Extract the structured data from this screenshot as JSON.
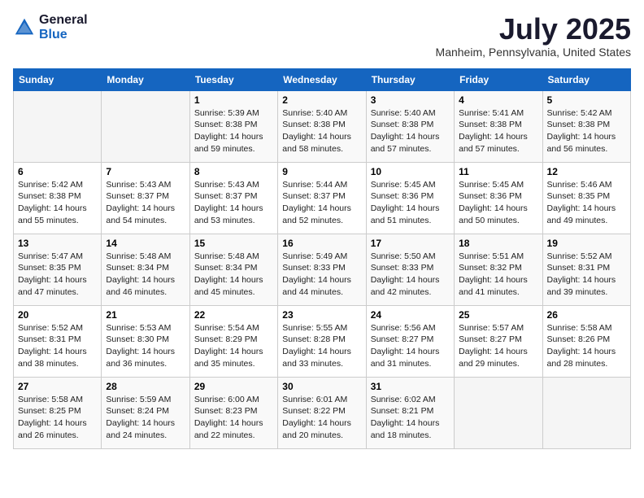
{
  "header": {
    "logo_general": "General",
    "logo_blue": "Blue",
    "month_title": "July 2025",
    "location": "Manheim, Pennsylvania, United States"
  },
  "days_of_week": [
    "Sunday",
    "Monday",
    "Tuesday",
    "Wednesday",
    "Thursday",
    "Friday",
    "Saturday"
  ],
  "weeks": [
    [
      {
        "day": "",
        "info": ""
      },
      {
        "day": "",
        "info": ""
      },
      {
        "day": "1",
        "sunrise": "5:39 AM",
        "sunset": "8:38 PM",
        "daylight": "14 hours and 59 minutes."
      },
      {
        "day": "2",
        "sunrise": "5:40 AM",
        "sunset": "8:38 PM",
        "daylight": "14 hours and 58 minutes."
      },
      {
        "day": "3",
        "sunrise": "5:40 AM",
        "sunset": "8:38 PM",
        "daylight": "14 hours and 57 minutes."
      },
      {
        "day": "4",
        "sunrise": "5:41 AM",
        "sunset": "8:38 PM",
        "daylight": "14 hours and 57 minutes."
      },
      {
        "day": "5",
        "sunrise": "5:42 AM",
        "sunset": "8:38 PM",
        "daylight": "14 hours and 56 minutes."
      }
    ],
    [
      {
        "day": "6",
        "sunrise": "5:42 AM",
        "sunset": "8:38 PM",
        "daylight": "14 hours and 55 minutes."
      },
      {
        "day": "7",
        "sunrise": "5:43 AM",
        "sunset": "8:37 PM",
        "daylight": "14 hours and 54 minutes."
      },
      {
        "day": "8",
        "sunrise": "5:43 AM",
        "sunset": "8:37 PM",
        "daylight": "14 hours and 53 minutes."
      },
      {
        "day": "9",
        "sunrise": "5:44 AM",
        "sunset": "8:37 PM",
        "daylight": "14 hours and 52 minutes."
      },
      {
        "day": "10",
        "sunrise": "5:45 AM",
        "sunset": "8:36 PM",
        "daylight": "14 hours and 51 minutes."
      },
      {
        "day": "11",
        "sunrise": "5:45 AM",
        "sunset": "8:36 PM",
        "daylight": "14 hours and 50 minutes."
      },
      {
        "day": "12",
        "sunrise": "5:46 AM",
        "sunset": "8:35 PM",
        "daylight": "14 hours and 49 minutes."
      }
    ],
    [
      {
        "day": "13",
        "sunrise": "5:47 AM",
        "sunset": "8:35 PM",
        "daylight": "14 hours and 47 minutes."
      },
      {
        "day": "14",
        "sunrise": "5:48 AM",
        "sunset": "8:34 PM",
        "daylight": "14 hours and 46 minutes."
      },
      {
        "day": "15",
        "sunrise": "5:48 AM",
        "sunset": "8:34 PM",
        "daylight": "14 hours and 45 minutes."
      },
      {
        "day": "16",
        "sunrise": "5:49 AM",
        "sunset": "8:33 PM",
        "daylight": "14 hours and 44 minutes."
      },
      {
        "day": "17",
        "sunrise": "5:50 AM",
        "sunset": "8:33 PM",
        "daylight": "14 hours and 42 minutes."
      },
      {
        "day": "18",
        "sunrise": "5:51 AM",
        "sunset": "8:32 PM",
        "daylight": "14 hours and 41 minutes."
      },
      {
        "day": "19",
        "sunrise": "5:52 AM",
        "sunset": "8:31 PM",
        "daylight": "14 hours and 39 minutes."
      }
    ],
    [
      {
        "day": "20",
        "sunrise": "5:52 AM",
        "sunset": "8:31 PM",
        "daylight": "14 hours and 38 minutes."
      },
      {
        "day": "21",
        "sunrise": "5:53 AM",
        "sunset": "8:30 PM",
        "daylight": "14 hours and 36 minutes."
      },
      {
        "day": "22",
        "sunrise": "5:54 AM",
        "sunset": "8:29 PM",
        "daylight": "14 hours and 35 minutes."
      },
      {
        "day": "23",
        "sunrise": "5:55 AM",
        "sunset": "8:28 PM",
        "daylight": "14 hours and 33 minutes."
      },
      {
        "day": "24",
        "sunrise": "5:56 AM",
        "sunset": "8:27 PM",
        "daylight": "14 hours and 31 minutes."
      },
      {
        "day": "25",
        "sunrise": "5:57 AM",
        "sunset": "8:27 PM",
        "daylight": "14 hours and 29 minutes."
      },
      {
        "day": "26",
        "sunrise": "5:58 AM",
        "sunset": "8:26 PM",
        "daylight": "14 hours and 28 minutes."
      }
    ],
    [
      {
        "day": "27",
        "sunrise": "5:58 AM",
        "sunset": "8:25 PM",
        "daylight": "14 hours and 26 minutes."
      },
      {
        "day": "28",
        "sunrise": "5:59 AM",
        "sunset": "8:24 PM",
        "daylight": "14 hours and 24 minutes."
      },
      {
        "day": "29",
        "sunrise": "6:00 AM",
        "sunset": "8:23 PM",
        "daylight": "14 hours and 22 minutes."
      },
      {
        "day": "30",
        "sunrise": "6:01 AM",
        "sunset": "8:22 PM",
        "daylight": "14 hours and 20 minutes."
      },
      {
        "day": "31",
        "sunrise": "6:02 AM",
        "sunset": "8:21 PM",
        "daylight": "14 hours and 18 minutes."
      },
      {
        "day": "",
        "info": ""
      },
      {
        "day": "",
        "info": ""
      }
    ]
  ],
  "labels": {
    "sunrise_prefix": "Sunrise: ",
    "sunset_prefix": "Sunset: ",
    "daylight_prefix": "Daylight: "
  }
}
